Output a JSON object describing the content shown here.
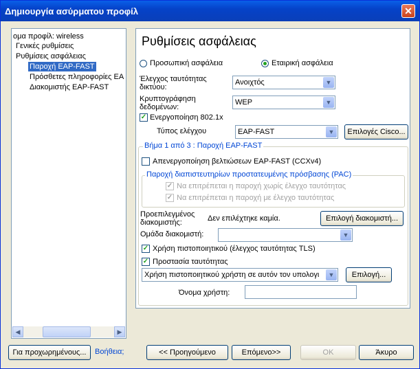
{
  "window": {
    "title": "Δημιουργία ασύρματου προφίλ",
    "close_glyph": "✕"
  },
  "tree": {
    "items": [
      "ομα προφίλ: wireless",
      "Γενικές ρυθμίσεις",
      "Ρυθμίσεις ασφάλειας",
      "Παροχή EAP-FAST",
      "Πρόσθετες πληροφορίες EA",
      "Διακομιστής EAP-FAST"
    ],
    "selected_index": 3
  },
  "panel": {
    "title": "Ρυθμίσεις ασφάλειας",
    "radio_personal": "Προσωπική ασφάλεια",
    "radio_enterprise": "Εταιρική ασφάλεια",
    "auth_label": "Έλεγχος ταυτότητας δικτύου:",
    "auth_value": "Ανοιχτός",
    "enc_label": "Κρυπτογράφηση δεδομένων:",
    "enc_value": "WEP",
    "enable_8021x": "Ενεργοποίηση 802.1x",
    "auth_type_label": "Τύπος ελέγχου",
    "auth_type_value": "EAP-FAST",
    "cisco_options_button": "Επιλογές Cisco...",
    "step_group": {
      "label": "Βήμα 1 από 3 : Παροχή EAP-FAST",
      "disable_enhancements": "Απενεργοποίηση βελτιώσεων EAP-FAST (CCXv4)",
      "pac_group": {
        "label": "Παροχή διαπιστευτηρίων προστατευμένης πρόσβασης (PAC)",
        "allow_unauth": "Να επιτρέπεται η παροχή χωρίς έλεγχο ταυτότητας",
        "allow_auth": "Να επιτρέπεται η παροχή με έλεγχο ταυτότητας"
      },
      "default_server_label": "Προεπιλεγμένος διακομιστής:",
      "default_server_value": "Δεν επιλέχτηκε καμία.",
      "select_server_button": "Επιλογή διακομιστή...",
      "server_group_label": "Ομάδα διακομιστή:",
      "server_group_value": "",
      "use_certificate": "Χρήση πιστοποιητικού (έλεγχος ταυτότητας TLS)",
      "identity_protection": "Προστασία ταυτότητας",
      "cert_select_value": "Χρήση πιστοποιητικού χρήστη σε αυτόν τον υπολογι",
      "select_button": "Επιλογή...",
      "username_label": "Όνομα χρήστη:",
      "username_value": ""
    }
  },
  "footer": {
    "advanced_button": "Για προχωρημένους...",
    "help_link": "Βοήθεια;",
    "back_button": "<< Προηγούμενο",
    "next_button": "Επόμενο>>",
    "ok_button": "OK",
    "cancel_button": "Άκυρο"
  },
  "icons": {
    "dropdown_arrow": "▼",
    "check": "✓",
    "scroll_left": "◀",
    "scroll_right": "▶"
  }
}
